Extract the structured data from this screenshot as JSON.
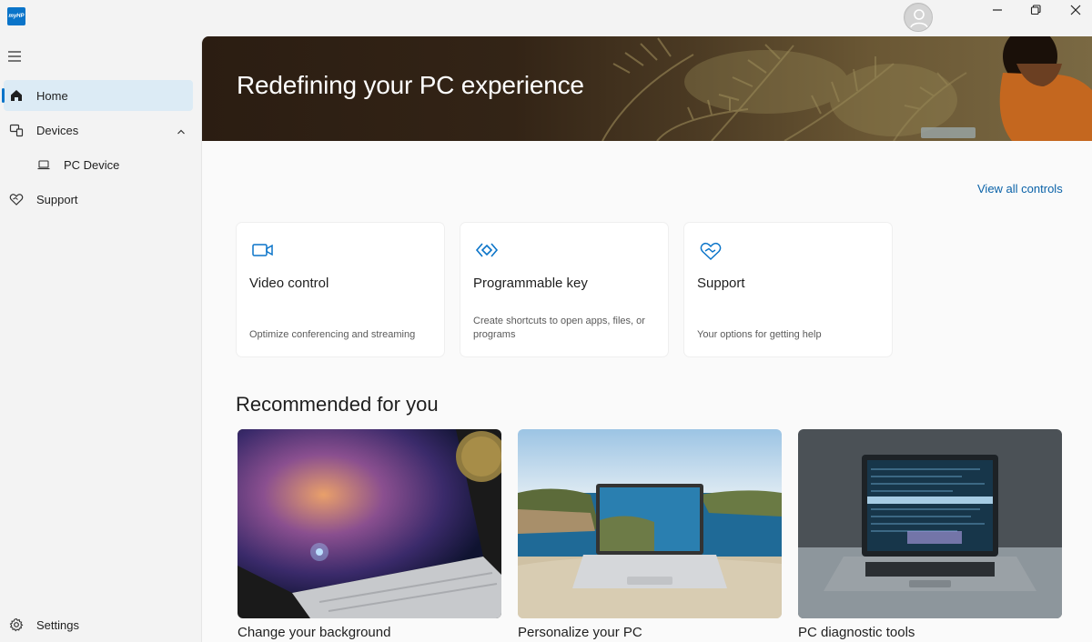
{
  "titlebar": {
    "logo_text": "myHP",
    "avatar_icon": "user-avatar-icon",
    "minimize_icon": "minimize-icon",
    "restore_icon": "restore-icon",
    "close_icon": "close-icon"
  },
  "sidebar": {
    "menu_icon": "hamburger-icon",
    "items": [
      {
        "label": "Home",
        "icon": "home-icon",
        "active": true
      },
      {
        "label": "Devices",
        "icon": "devices-icon",
        "expanded": true
      },
      {
        "label": "PC Device",
        "icon": "laptop-icon"
      },
      {
        "label": "Support",
        "icon": "support-heart-icon"
      }
    ],
    "settings": {
      "label": "Settings",
      "icon": "gear-icon"
    }
  },
  "hero": {
    "title": "Redefining your PC experience"
  },
  "controls": {
    "view_all": "View all controls",
    "cards": [
      {
        "title": "Video control",
        "desc": "Optimize conferencing and streaming",
        "icon": "video-camera-icon"
      },
      {
        "title": "Programmable key",
        "desc": "Create shortcuts to open apps, files, or programs",
        "icon": "programmable-key-icon"
      },
      {
        "title": "Support",
        "desc": "Your options for getting help",
        "icon": "support-heart-icon"
      }
    ]
  },
  "recommended": {
    "title": "Recommended for you",
    "items": [
      {
        "title": "Change your background"
      },
      {
        "title": "Personalize your PC"
      },
      {
        "title": "PC diagnostic tools"
      }
    ]
  },
  "colors": {
    "accent": "#0a74c9",
    "link": "#0a62a8",
    "active_nav_bg": "#dcebf5"
  }
}
